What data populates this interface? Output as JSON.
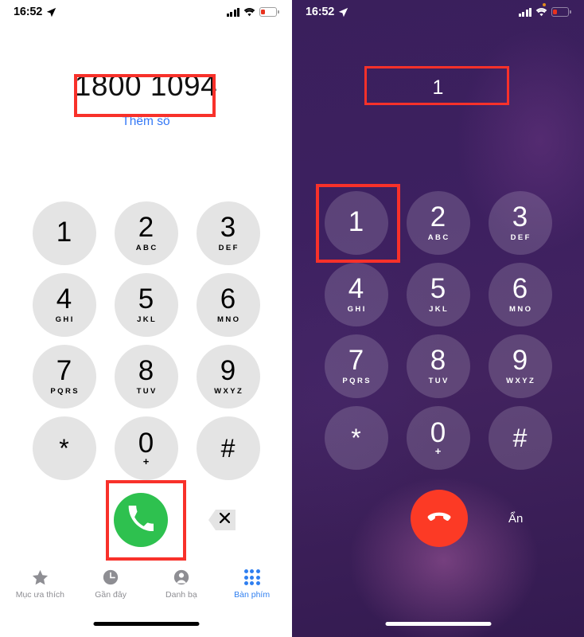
{
  "left_screen": {
    "status_bar": {
      "time": "16:52",
      "icons": [
        "location-arrow-icon",
        "cellular-signal-icon",
        "wifi-icon",
        "battery-low-icon"
      ]
    },
    "dialed_number": "1800 1094",
    "add_number_label": "Thêm số",
    "keypad": [
      {
        "digit": "1",
        "letters": ""
      },
      {
        "digit": "2",
        "letters": "ABC"
      },
      {
        "digit": "3",
        "letters": "DEF"
      },
      {
        "digit": "4",
        "letters": "GHI"
      },
      {
        "digit": "5",
        "letters": "JKL"
      },
      {
        "digit": "6",
        "letters": "MNO"
      },
      {
        "digit": "7",
        "letters": "PQRS"
      },
      {
        "digit": "8",
        "letters": "TUV"
      },
      {
        "digit": "9",
        "letters": "WXYZ"
      },
      {
        "digit": "*",
        "letters": ""
      },
      {
        "digit": "0",
        "letters": "+"
      },
      {
        "digit": "#",
        "letters": ""
      }
    ],
    "call_button": "call-icon",
    "backspace_button": "backspace-icon",
    "tabs": [
      {
        "label": "Mục ưa thích",
        "icon": "star-icon",
        "active": false
      },
      {
        "label": "Gần đây",
        "icon": "clock-icon",
        "active": false
      },
      {
        "label": "Danh bạ",
        "icon": "person-icon",
        "active": false
      },
      {
        "label": "Bàn phím",
        "icon": "keypad-grid-icon",
        "active": true
      }
    ]
  },
  "right_screen": {
    "status_bar": {
      "time": "16:52",
      "icons": [
        "location-arrow-icon",
        "cellular-signal-icon",
        "wifi-icon",
        "battery-low-icon"
      ]
    },
    "entered_digits": "1",
    "keypad": [
      {
        "digit": "1",
        "letters": ""
      },
      {
        "digit": "2",
        "letters": "ABC"
      },
      {
        "digit": "3",
        "letters": "DEF"
      },
      {
        "digit": "4",
        "letters": "GHI"
      },
      {
        "digit": "5",
        "letters": "JKL"
      },
      {
        "digit": "6",
        "letters": "MNO"
      },
      {
        "digit": "7",
        "letters": "PQRS"
      },
      {
        "digit": "8",
        "letters": "TUV"
      },
      {
        "digit": "9",
        "letters": "WXYZ"
      },
      {
        "digit": "*",
        "letters": ""
      },
      {
        "digit": "0",
        "letters": "+"
      },
      {
        "digit": "#",
        "letters": ""
      }
    ],
    "end_call_button": "end-call-icon",
    "hide_label": "Ẩn"
  },
  "colors": {
    "accent_blue": "#2f7ff0",
    "link_blue": "#3478f6",
    "call_green": "#2ec14f",
    "end_red": "#fc3a25",
    "highlight_red": "#f8312a",
    "key_light": "#e4e4e4",
    "call_bg_purple": "#3a1f5c",
    "battery_red": "#e8321e"
  }
}
